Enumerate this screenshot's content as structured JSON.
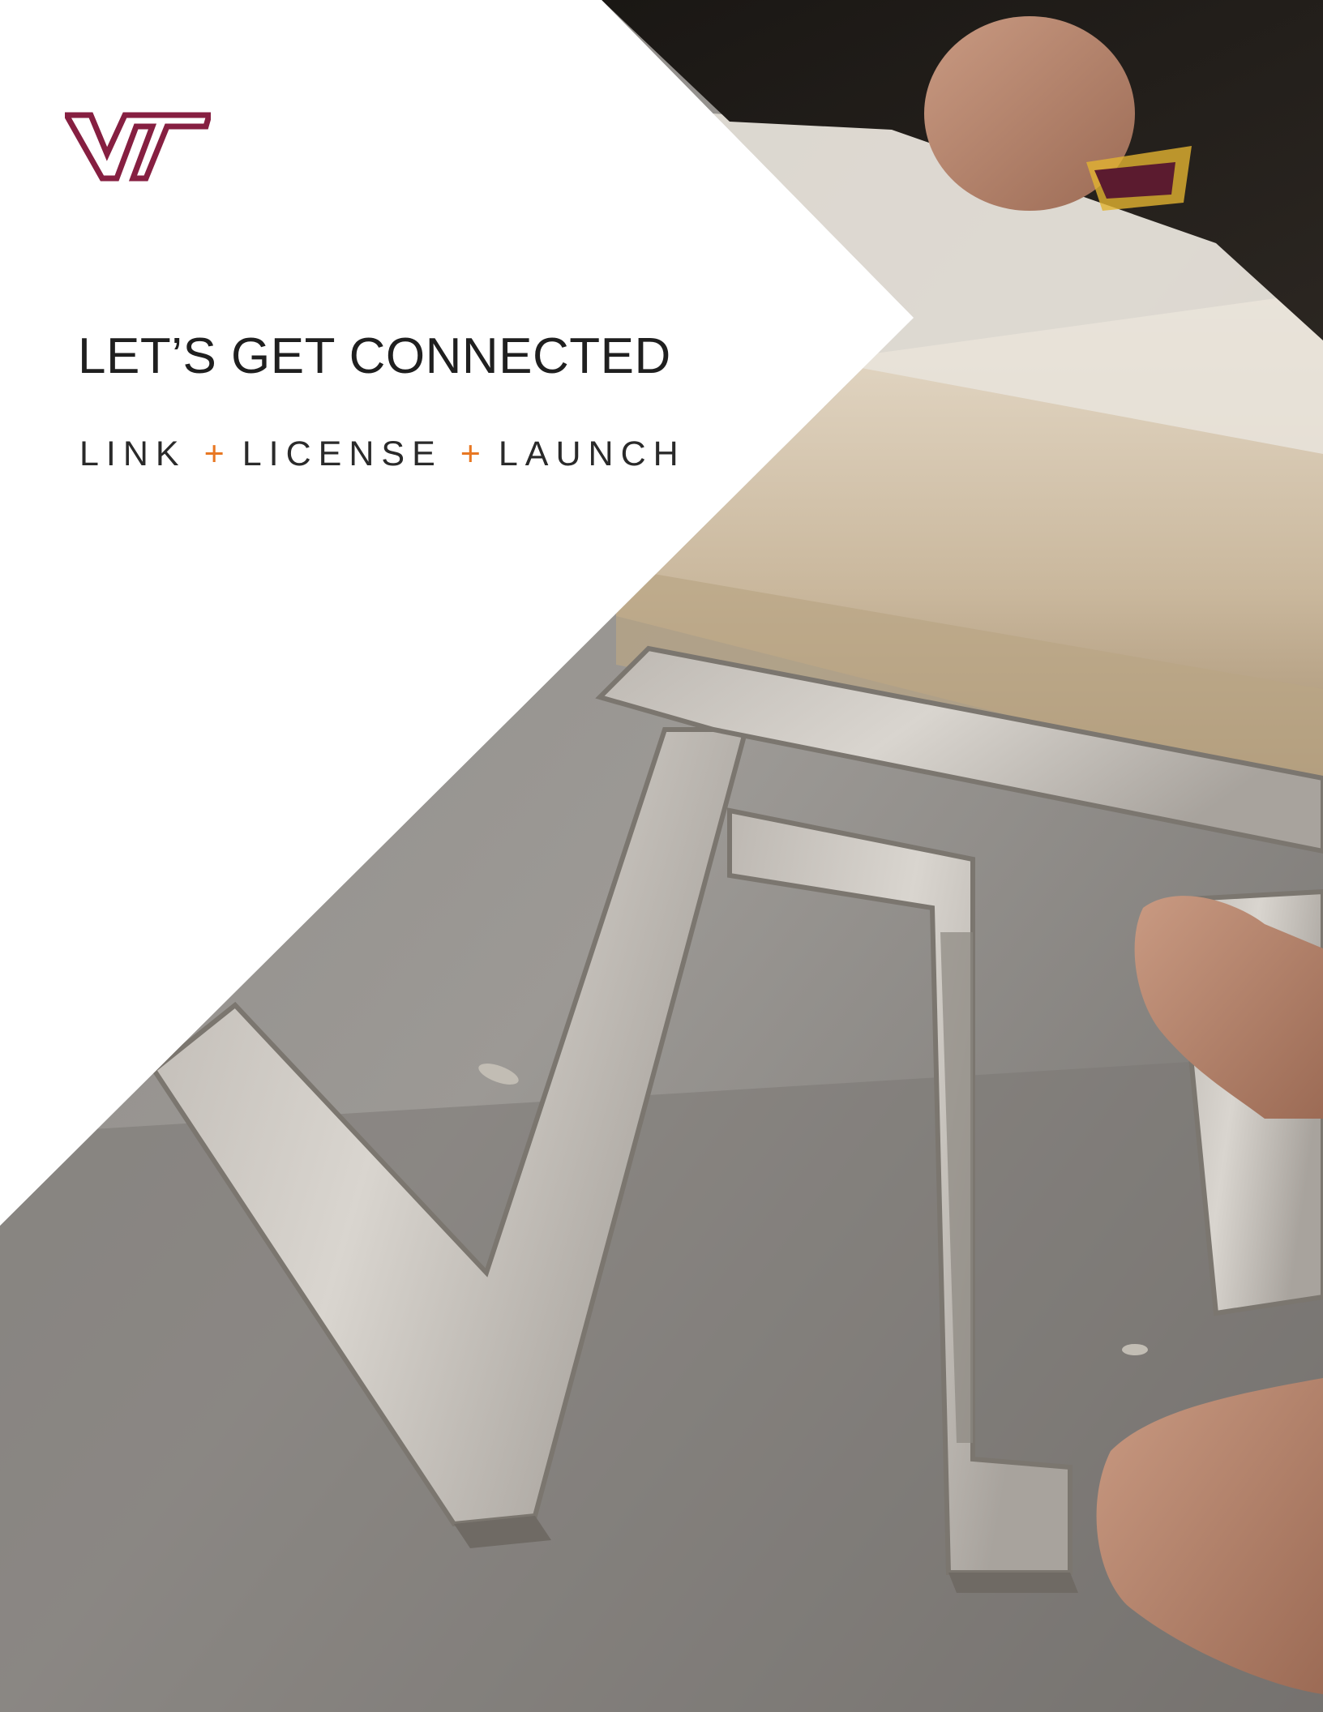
{
  "cover": {
    "title": "LET’S GET CONNECTED",
    "tagline": {
      "word1": "LINK",
      "sep1": "+",
      "word2": "LICENSE",
      "sep2": "+",
      "word3": "LAUNCH"
    }
  },
  "logo": {
    "text": "VT",
    "color": "#861F41",
    "icon": "vt-logo-icon"
  },
  "colors": {
    "accent": "#E87722",
    "maroon": "#861F41",
    "text": "#1F1F1F"
  },
  "photo": {
    "subject": "brushed-metal-letters-photo"
  }
}
